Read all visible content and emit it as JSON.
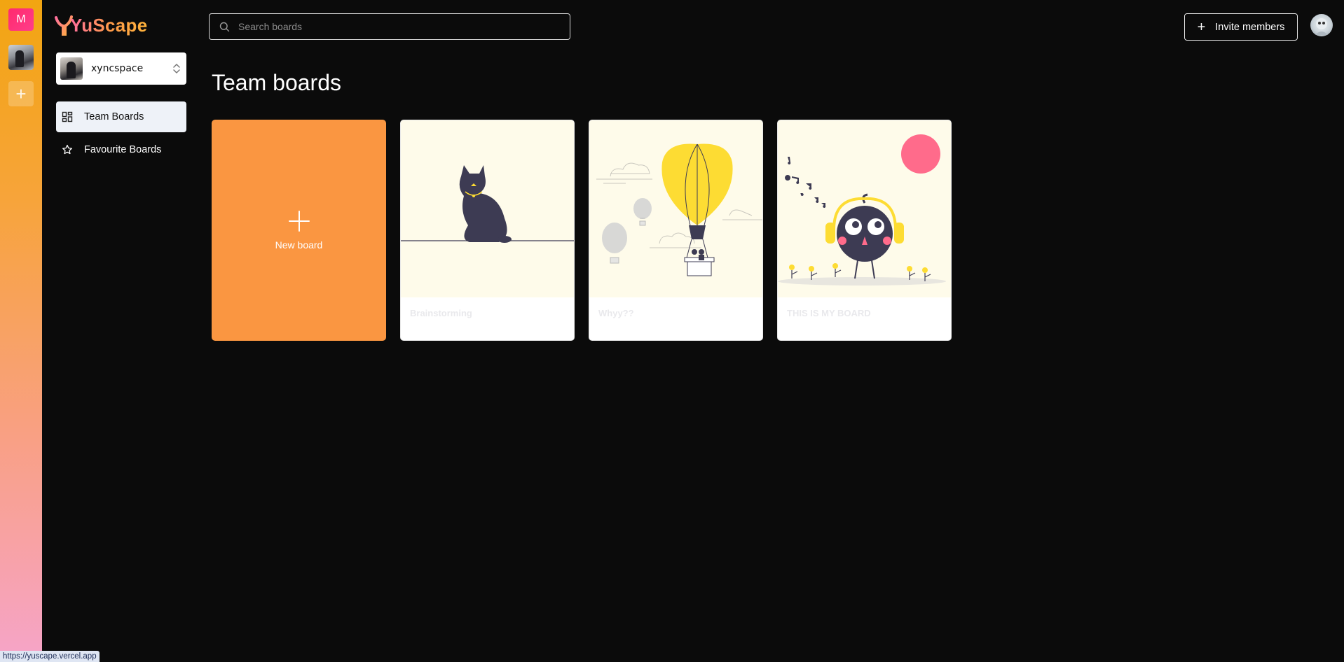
{
  "app": {
    "brand": "YuScape"
  },
  "org_rail": {
    "orgs": [
      {
        "initial": "M",
        "color": "#ff2a6d"
      },
      {
        "initial": ""
      }
    ],
    "add_label": "+"
  },
  "workspace": {
    "name": "xyncspace"
  },
  "nav": {
    "items": [
      {
        "label": "Team Boards",
        "icon": "dashboard-grid-icon",
        "active": true
      },
      {
        "label": "Favourite Boards",
        "icon": "star-icon",
        "active": false
      }
    ]
  },
  "search": {
    "placeholder": "Search boards",
    "value": ""
  },
  "header": {
    "invite_label": "Invite members"
  },
  "page": {
    "title": "Team boards"
  },
  "boards": {
    "new_label": "New board",
    "items": [
      {
        "title": "Brainstorming",
        "illustration": "cat-on-wire"
      },
      {
        "title": "Whyy??",
        "illustration": "hot-air-balloon"
      },
      {
        "title": "THIS IS MY BOARD",
        "illustration": "bird-with-headphones"
      }
    ]
  },
  "status_bar": {
    "url": "https://yuscape.vercel.app"
  },
  "colors": {
    "background": "#0b0b0b",
    "new_board": "#fa9641",
    "thumb_bg": "#fefbea",
    "accent_yellow": "#fddc33",
    "accent_pink": "#ff6b8b"
  }
}
